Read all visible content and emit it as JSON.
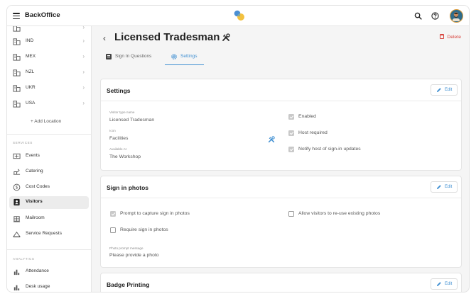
{
  "app": {
    "title": "BackOffice"
  },
  "sidebar": {
    "locations": [
      {
        "label": "IND"
      },
      {
        "label": "MEX"
      },
      {
        "label": "NZL"
      },
      {
        "label": "UKR"
      },
      {
        "label": "USA"
      }
    ],
    "add_location": "+ Add Location",
    "services_heading": "SERVICES",
    "services": [
      {
        "label": "Events",
        "icon": "events-icon"
      },
      {
        "label": "Catering",
        "icon": "catering-icon"
      },
      {
        "label": "Cost Codes",
        "icon": "cost-codes-icon"
      },
      {
        "label": "Visitors",
        "icon": "visitors-icon",
        "active": true
      },
      {
        "label": "Mailroom",
        "icon": "mailroom-icon"
      },
      {
        "label": "Service Requests",
        "icon": "service-requests-icon"
      }
    ],
    "analytics_heading": "ANALYTICS",
    "analytics": [
      {
        "label": "Attendance",
        "icon": "bar-chart-icon"
      },
      {
        "label": "Desk usage",
        "icon": "bar-chart-icon"
      }
    ]
  },
  "page": {
    "title": "Licensed Tradesman",
    "delete_label": "Delete",
    "tabs": [
      {
        "label": "Sign In Questions",
        "active": false
      },
      {
        "label": "Settings",
        "active": true
      }
    ]
  },
  "settings_card": {
    "title": "Settings",
    "edit_label": "Edit",
    "fields": [
      {
        "label": "Visitor type name",
        "value": "Licensed Tradesman"
      },
      {
        "label": "Icon",
        "value": "Facilities"
      },
      {
        "label": "Available At",
        "value": "The Workshop"
      }
    ],
    "checks": [
      {
        "label": "Enabled",
        "checked": true
      },
      {
        "label": "Host required",
        "checked": true
      },
      {
        "label": "Notify host of sign-in updates",
        "checked": true
      }
    ]
  },
  "photos_card": {
    "title": "Sign in photos",
    "edit_label": "Edit",
    "checks": [
      {
        "label": "Prompt to capture sign in photos",
        "checked": true
      },
      {
        "label": "Require sign in photos",
        "checked": false
      },
      {
        "label": "Allow visitors to re-use existing photos",
        "checked": false
      }
    ],
    "prompt_label": "Photo prompt message",
    "prompt_value": "Please provide a photo"
  },
  "badge_card": {
    "title": "Badge Printing",
    "edit_label": "Edit"
  },
  "colors": {
    "accent": "#3f8fd2",
    "danger": "#d8453f",
    "active_bg": "#ececec"
  }
}
